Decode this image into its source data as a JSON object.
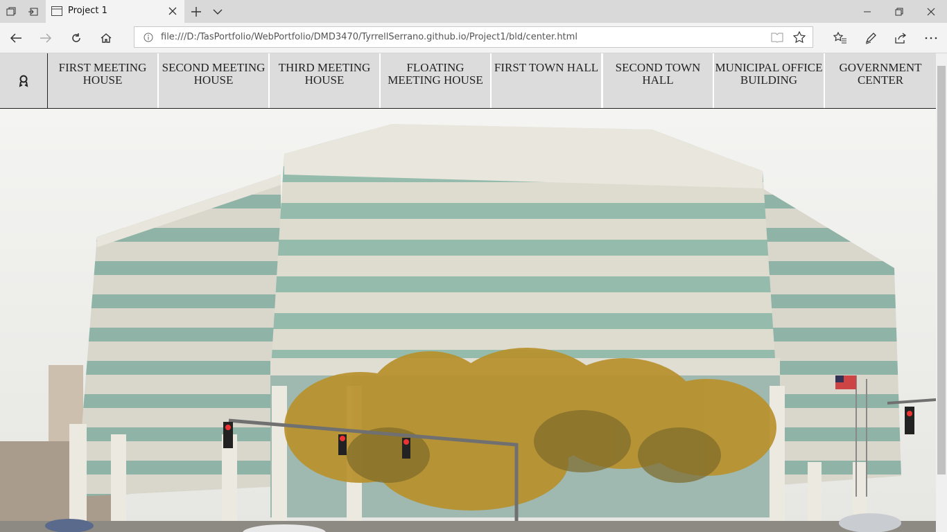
{
  "browser": {
    "tab": {
      "title": "Project 1"
    },
    "address": {
      "url": "file:///D:/TasPortfolio/WebPortfolio/DMD3470/TyrrellSerrano.github.io/Project1/bld/center.html"
    }
  },
  "site": {
    "nav": [
      {
        "label": "FIRST MEETING HOUSE"
      },
      {
        "label": "SECOND MEETING HOUSE"
      },
      {
        "label": "THIRD MEETING HOUSE"
      },
      {
        "label": "FLOATING MEETING HOUSE"
      },
      {
        "label": "FIRST TOWN HALL"
      },
      {
        "label": "SECOND TOWN HALL"
      },
      {
        "label": "MUNICIPAL OFFICE BUILDING"
      },
      {
        "label": "GOVERNMENT CENTER"
      }
    ]
  },
  "colors": {
    "nav_bg": "#dcdcdc",
    "chrome_bg": "#f3f3f3",
    "tabstrip_bg": "#d9d9d9"
  }
}
